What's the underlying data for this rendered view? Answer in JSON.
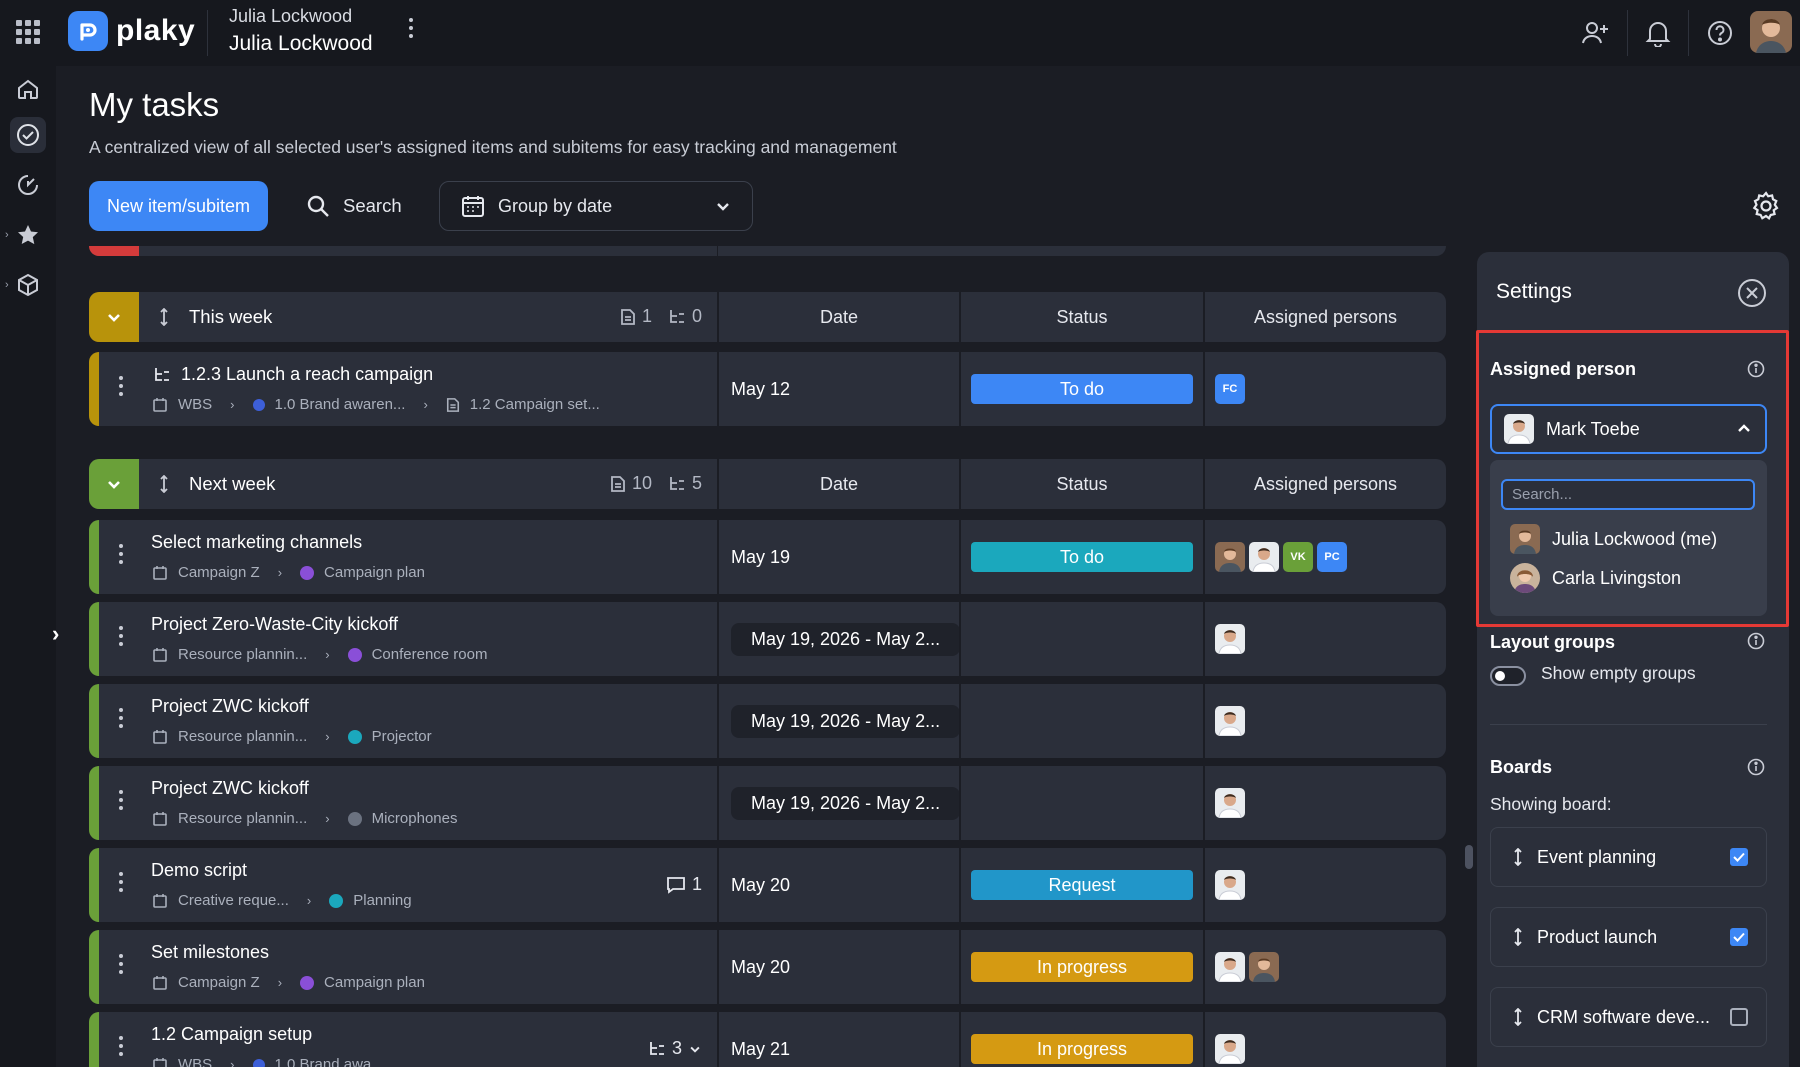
{
  "app": {
    "name": "plaky",
    "workspace_user_small": "Julia Lockwood",
    "workspace_user": "Julia Lockwood"
  },
  "page": {
    "title": "My tasks",
    "subtitle": "A centralized view of all selected user's assigned items and subitems for easy tracking and management"
  },
  "toolbar": {
    "new_label": "New item/subitem",
    "search_label": "Search",
    "group_label": "Group by date"
  },
  "columns": {
    "date": "Date",
    "status": "Status",
    "persons": "Assigned persons"
  },
  "groups": [
    {
      "name": "This week",
      "color": "#b8930b",
      "items_count": "1",
      "subitems_count": "0",
      "rows": [
        {
          "title": "1.2.3 Launch a reach campaign",
          "subitem": true,
          "crumb1": "WBS",
          "crumb2": "1.0 Brand awaren...",
          "crumb3": "1.2 Campaign set...",
          "date": "May 12",
          "status": "To do",
          "status_color": "#3d87f5",
          "persons": [
            {
              "initials": "FC",
              "color": "#3d87f5"
            }
          ]
        }
      ]
    },
    {
      "name": "Next week",
      "color": "#6aa039",
      "items_count": "10",
      "subitems_count": "5",
      "rows": [
        {
          "title": "Select marketing channels",
          "crumb1": "Campaign Z",
          "crumb2": "Campaign plan",
          "dot": "#8a4fd8",
          "date": "May 19",
          "status": "To do",
          "status_color": "#1ba8bd",
          "persons": [
            {
              "initials": "",
              "photo": "b"
            },
            {
              "initials": "",
              "photo": "a"
            },
            {
              "initials": "VK",
              "color": "#6aa039"
            },
            {
              "initials": "PC",
              "color": "#3d87f5"
            }
          ]
        },
        {
          "title": "Project Zero-Waste-City kickoff",
          "crumb1": "Resource plannin...",
          "crumb2": "Conference room",
          "dot": "#8a4fd8",
          "date": "May 19, 2026 - May 2...",
          "persons": [
            {
              "photo": "a"
            }
          ]
        },
        {
          "title": "Project ZWC kickoff",
          "crumb1": "Resource plannin...",
          "crumb2": "Projector",
          "dot": "#1ba8bd",
          "date": "May 19, 2026 - May 2...",
          "persons": [
            {
              "photo": "a"
            }
          ]
        },
        {
          "title": "Project ZWC kickoff",
          "crumb1": "Resource plannin...",
          "crumb2": "Microphones",
          "dot": "#6b7280",
          "date": "May 19, 2026 - May 2...",
          "persons": [
            {
              "photo": "a"
            }
          ]
        },
        {
          "title": "Demo script",
          "crumb1": "Creative reque...",
          "crumb2": "Planning",
          "dot": "#1ba8bd",
          "comments": "1",
          "date": "May 20",
          "status": "Request",
          "status_color": "#2196c9",
          "persons": [
            {
              "photo": "a"
            }
          ]
        },
        {
          "title": "Set milestones",
          "crumb1": "Campaign Z",
          "crumb2": "Campaign plan",
          "dot": "#8a4fd8",
          "date": "May 20",
          "status": "In progress",
          "status_color": "#d59a12",
          "persons": [
            {
              "photo": "a"
            },
            {
              "photo": "b"
            }
          ]
        },
        {
          "title": "1.2 Campaign setup",
          "crumb1": "WBS",
          "crumb2": "1.0 Brand awa...",
          "subitems": "3",
          "date": "May 21",
          "status": "In progress",
          "status_color": "#d59a12",
          "persons": [
            {
              "photo": "a"
            }
          ]
        }
      ]
    }
  ],
  "settings": {
    "title": "Settings",
    "assigned_person_title": "Assigned person",
    "selected_person": "Mark Toebe",
    "search_placeholder": "Search...",
    "options": [
      "Julia Lockwood (me)",
      "Carla Livingston"
    ],
    "layout_title": "Layout groups",
    "show_empty_label": "Show empty groups",
    "show_empty_on": false,
    "boards_title": "Boards",
    "showing_label": "Showing board:",
    "boards": [
      {
        "name": "Event planning",
        "checked": true
      },
      {
        "name": "Product launch",
        "checked": true
      },
      {
        "name": "CRM software deve...",
        "checked": false
      }
    ]
  }
}
